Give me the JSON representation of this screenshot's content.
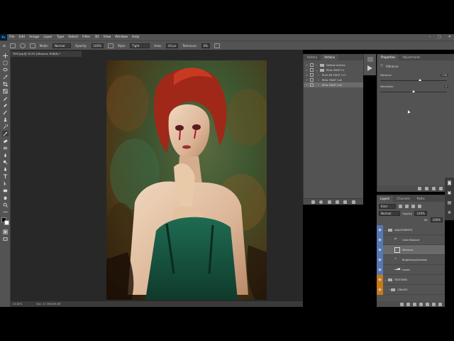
{
  "app": {
    "logo": "Ps",
    "menu": [
      "File",
      "Edit",
      "Image",
      "Layer",
      "Type",
      "Select",
      "Filter",
      "3D",
      "View",
      "Window",
      "Help"
    ],
    "window_controls": [
      "–",
      "□",
      "✕"
    ]
  },
  "options_bar": {
    "mode_label": "Mode:",
    "mode_value": "Normal",
    "opacity_label": "Opacity:",
    "opacity_value": "100%",
    "style_label": "Style:",
    "style_value": "Tight",
    "area_label": "Area:",
    "area_value": "20 px",
    "tolerance_label": "Tolerance:",
    "tolerance_value": "0%"
  },
  "document": {
    "tab_title": "TEST.jpg @ 25.5% (Vibrance, RGB/8) *",
    "zoom": "24.82%",
    "doc_size": "Doc: 17.3M/183.4M"
  },
  "actions_panel": {
    "tabs": [
      "History",
      "Actions"
    ],
    "active_tab": "Actions",
    "rows": [
      {
        "label": "Default Actions",
        "type": "folder",
        "expanded": false,
        "checked": true,
        "selected": false
      },
      {
        "label": "REAL PAINT Fx",
        "type": "folder",
        "expanded": true,
        "checked": true,
        "selected": false
      },
      {
        "label": "PLAY ME FIRST !!!!!",
        "type": "action",
        "expanded": false,
        "checked": true,
        "selected": false
      },
      {
        "label": "REAL PAINT 1x6",
        "type": "action",
        "expanded": false,
        "checked": true,
        "selected": false
      },
      {
        "label": "REAL PAINT 2x6",
        "type": "action",
        "expanded": false,
        "checked": true,
        "selected": true
      }
    ]
  },
  "properties_panel": {
    "tabs": [
      "Properties",
      "Adjustments"
    ],
    "active_tab": "Properties",
    "adjustment_name": "Vibrance",
    "sliders": [
      {
        "label": "Vibrance:",
        "value": "+30",
        "position": 0.6
      },
      {
        "label": "Saturation:",
        "value": "0",
        "position": 0.5
      }
    ]
  },
  "layers_panel": {
    "tabs": [
      "Layers",
      "Channels",
      "Paths"
    ],
    "active_tab": "Layers",
    "filter_kind": "Kind",
    "blend_mode": "Normal",
    "opacity_label": "Opacity:",
    "opacity_value": "100%",
    "fill_label": "Fill:",
    "fill_value": "100%",
    "layers": [
      {
        "name": "ADJUSTMENTS",
        "kind": "group",
        "color": "#5578b4",
        "selected": false,
        "indent": 0
      },
      {
        "name": "Color Balance",
        "kind": "adjust",
        "color": "#5578b4",
        "selected": false,
        "indent": 1
      },
      {
        "name": "Vibrance",
        "kind": "adjust",
        "color": "#5578b4",
        "selected": true,
        "indent": 1
      },
      {
        "name": "Brightness/Contrast",
        "kind": "adjust",
        "color": "#5578b4",
        "selected": false,
        "indent": 1
      },
      {
        "name": "Levels",
        "kind": "adjust",
        "color": "#5578b4",
        "selected": false,
        "indent": 1
      },
      {
        "name": "TEXTURES",
        "kind": "group",
        "color": "#c87a1a",
        "selected": false,
        "indent": 0
      },
      {
        "name": "CRACKS",
        "kind": "layer",
        "color": "#c87a1a",
        "selected": false,
        "indent": 1
      }
    ]
  },
  "colors": {
    "ui_bg": "#535353",
    "workspace": "#282828",
    "accent": "#31a8ff"
  }
}
